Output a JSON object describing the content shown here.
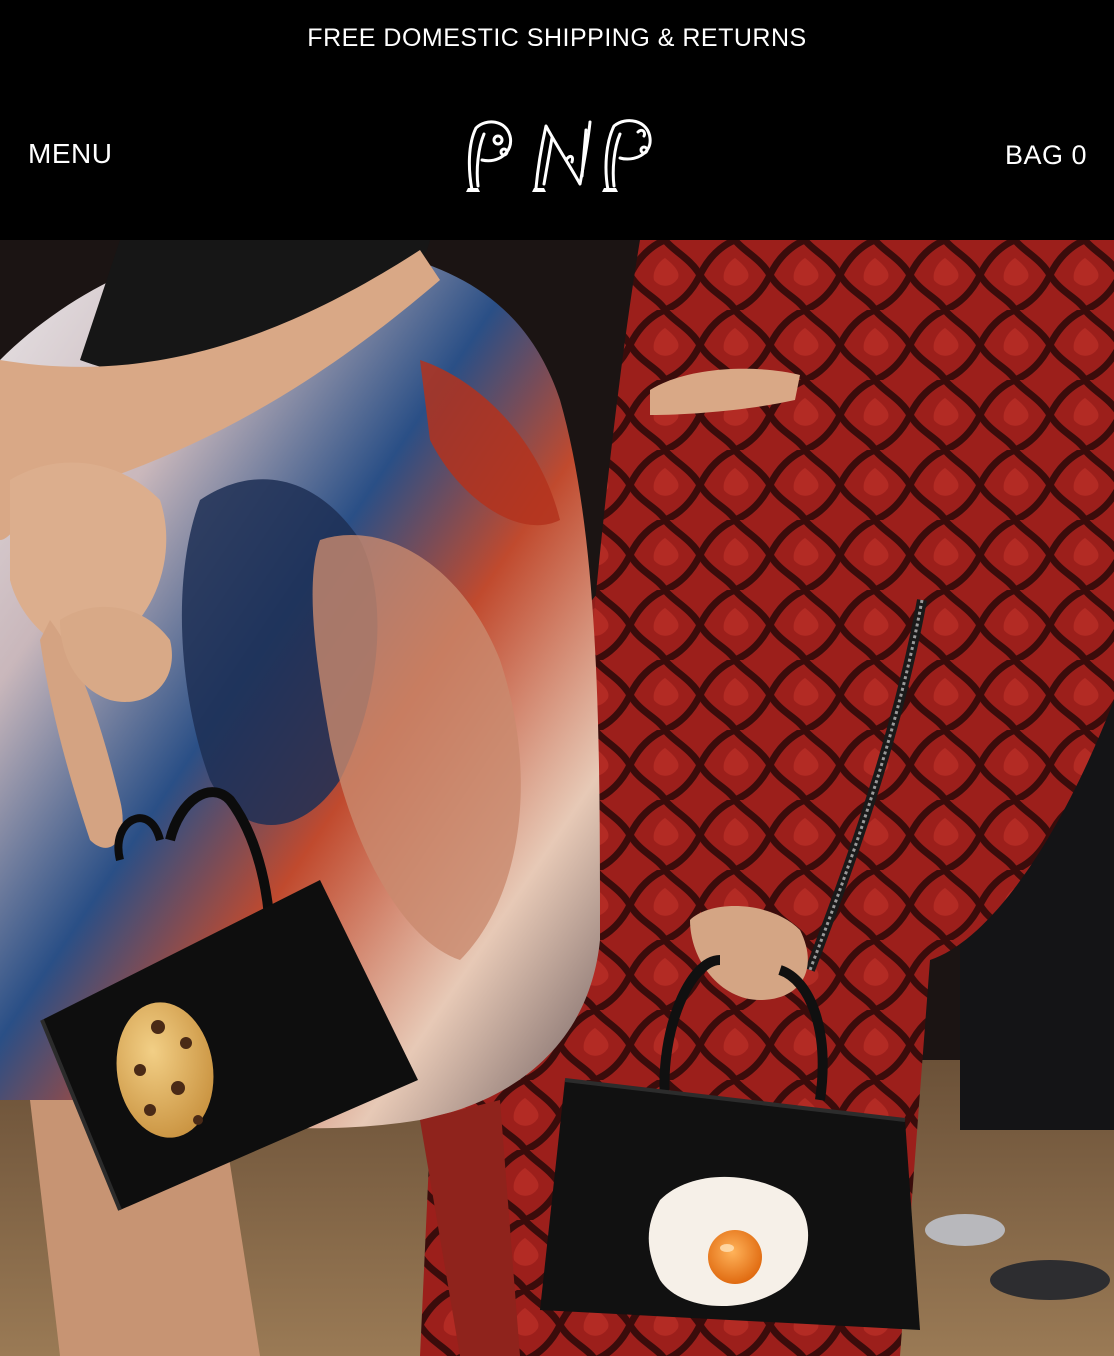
{
  "announcement": {
    "text": "FREE DOMESTIC SHIPPING & RETURNS"
  },
  "header": {
    "menu_label": "MENU",
    "logo_name": "pnp-logo",
    "bag_label": "BAG",
    "bag_count": "0"
  },
  "hero": {
    "image_name": "hero-photo"
  },
  "colors": {
    "background": "#000000",
    "text": "#ffffff",
    "snake_red": "#a8231f",
    "snake_dark": "#3a0d0c"
  }
}
